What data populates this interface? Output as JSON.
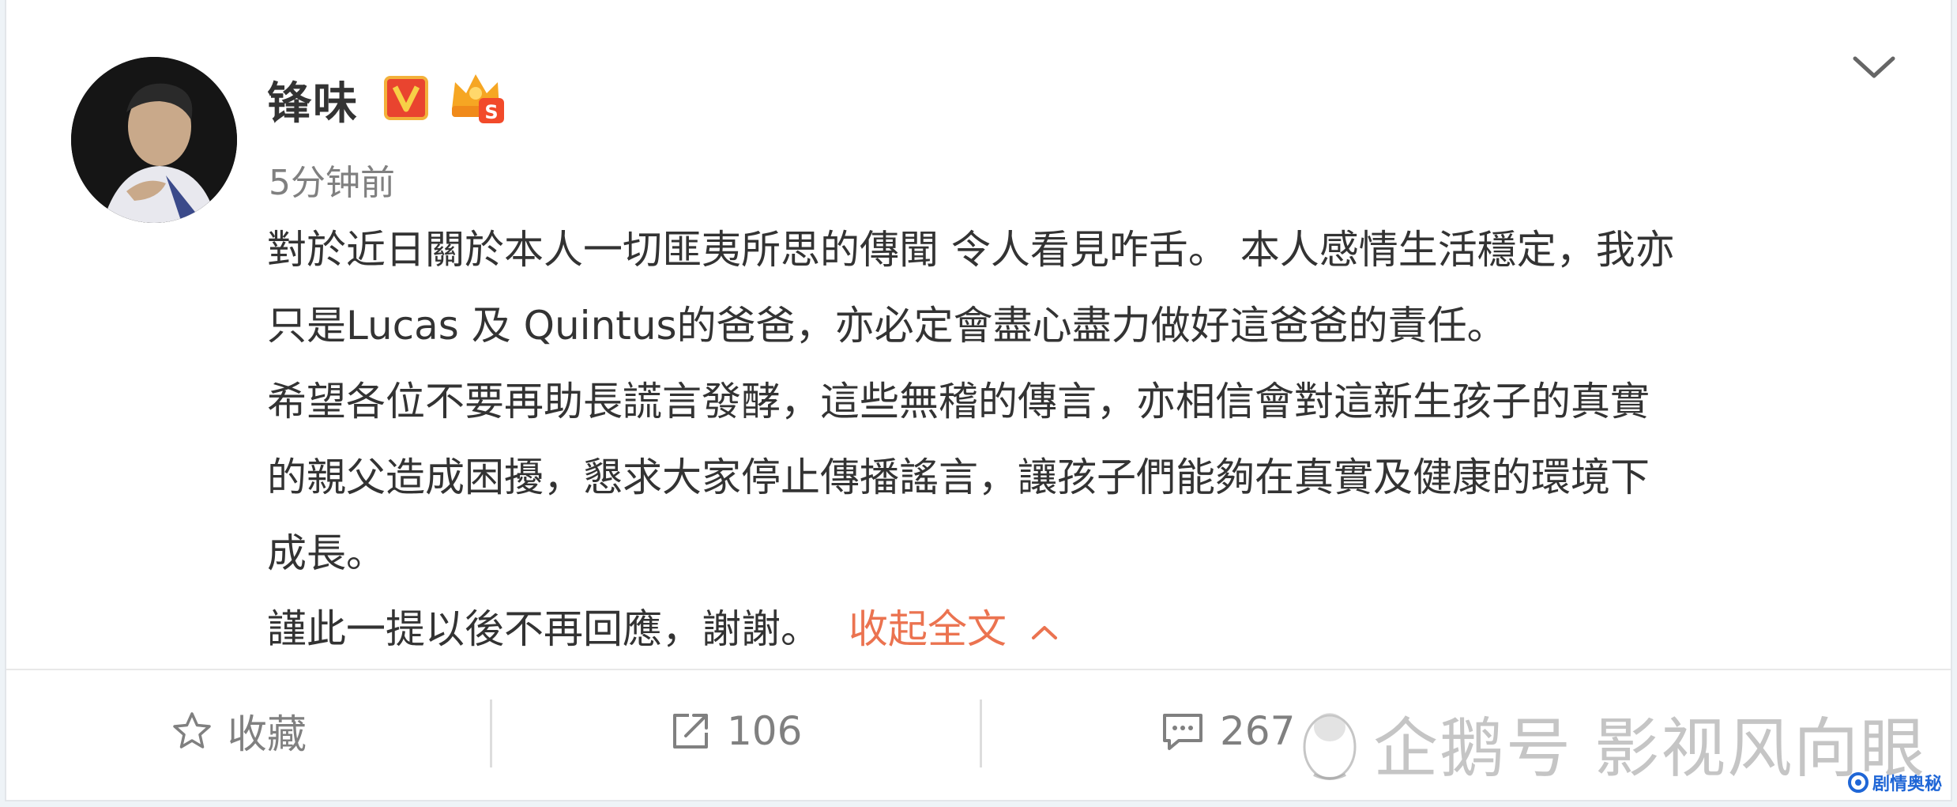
{
  "post": {
    "author_name": "锋味",
    "timestamp": "5分钟前",
    "lines": [
      "對於近日關於本人一切匪夷所思的傳聞 令人看見咋舌。 本人感情生活穩定，我亦",
      "只是Lucas 及 Quintus的爸爸，亦必定會盡心盡力做好這爸爸的責任。",
      "希望各位不要再助長謊言發酵，這些無稽的傳言，亦相信會對這新生孩子的真實",
      "的親父造成困擾，懇求大家停止傳播謠言，讓孩子們能夠在真實及健康的環境下",
      "成長。",
      "謹此一提以後不再回應，謝謝。"
    ],
    "collapse_label": "收起全文",
    "accent_color": "#eb7350"
  },
  "actions": {
    "favorite_label": "收藏",
    "repost_count": "106",
    "comment_count": "267"
  },
  "watermark": {
    "main_text": "企鹅号 影视风向眼",
    "corner_text": "剧情奥秘"
  }
}
